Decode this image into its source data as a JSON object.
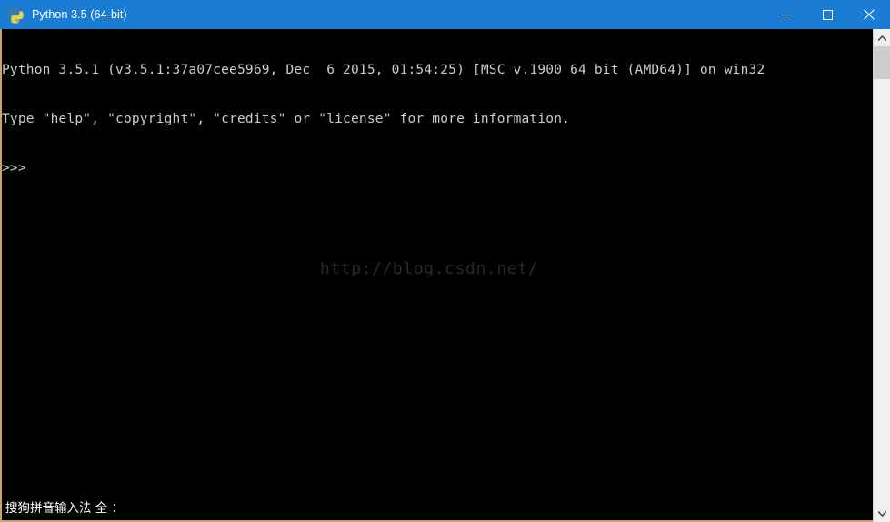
{
  "window": {
    "title": "Python 3.5 (64-bit)",
    "icon": "python-logo-icon",
    "titlebar_color": "#1b7cd4",
    "border_color": "#c8a46a",
    "background_color": "#000000"
  },
  "window_controls": {
    "minimize": "minimize-icon",
    "maximize": "maximize-icon",
    "close": "close-icon"
  },
  "console": {
    "text_color": "#cccccc",
    "lines": [
      "Python 3.5.1 (v3.5.1:37a07cee5969, Dec  6 2015, 01:54:25) [MSC v.1900 64 bit (AMD64)] on win32",
      "Type \"help\", \"copyright\", \"credits\" or \"license\" for more information.",
      ">>>"
    ],
    "line1": "Python 3.5.1 (v3.5.1:37a07cee5969, Dec  6 2015, 01:54:25) [MSC v.1900 64 bit (AMD64)] on win32",
    "line2": "Type \"help\", \"copyright\", \"credits\" or \"license\" for more information.",
    "prompt": ">>>"
  },
  "watermark": {
    "text": "http://blog.csdn.net/",
    "color": "#2a2a2a"
  },
  "ime": {
    "status_text": "搜狗拼音输入法 全 ："
  },
  "scrollbar": {
    "up_arrow": "chevron-up-icon",
    "down_arrow": "chevron-down-icon",
    "thumb_color": "#cdcdcd",
    "track_color": "#f0f0f0"
  }
}
